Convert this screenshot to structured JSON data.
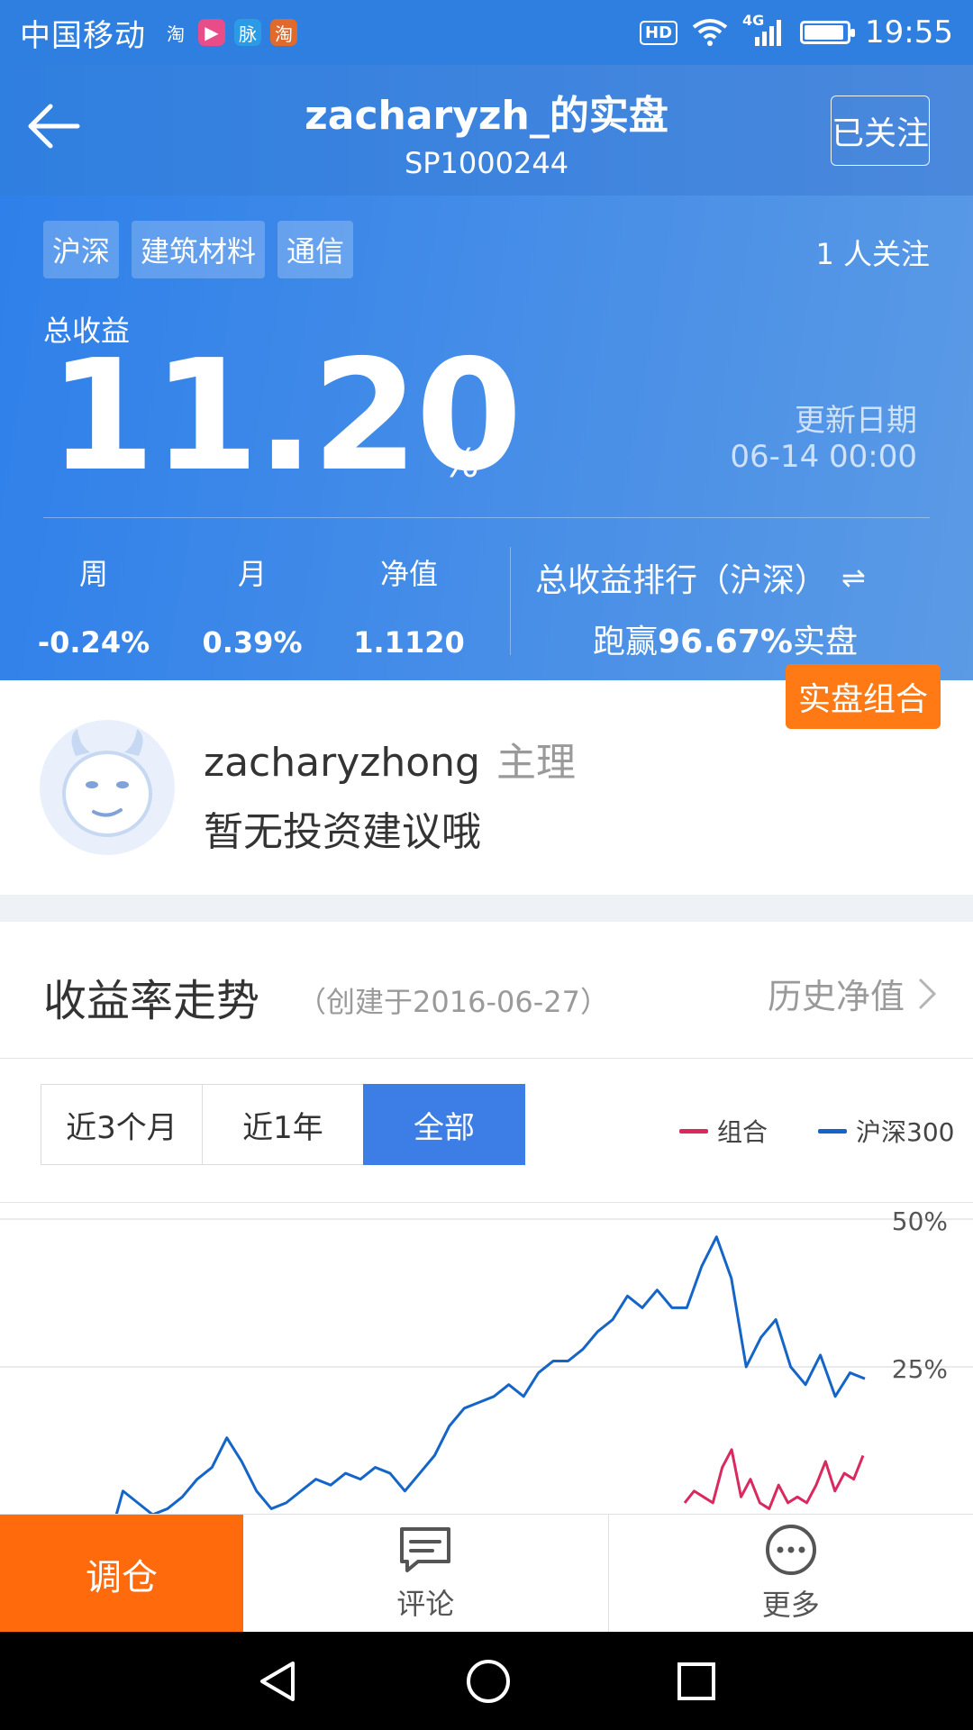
{
  "status_bar": {
    "carrier": "中国移动",
    "app_icons": [
      {
        "glyph": "淘",
        "name": "taobao-icon",
        "color": "#2f7fe0"
      },
      {
        "glyph": "▶",
        "name": "video-app-icon",
        "color": "#e84d8a"
      },
      {
        "glyph": "脉",
        "name": "maimai-icon",
        "color": "#2b9be6"
      },
      {
        "glyph": "淘",
        "name": "taobao-orange-icon",
        "color": "#e06a2c"
      }
    ],
    "network": "4G",
    "hd": "HD",
    "time": "19:55"
  },
  "header": {
    "title": "zacharyzh_的实盘",
    "subtitle": "SP1000244",
    "follow_label": "已关注"
  },
  "summary": {
    "tags": [
      "沪深",
      "建筑材料",
      "通信"
    ],
    "followers": "1 人关注",
    "total_return_label": "总收益",
    "total_return_value": "11.20",
    "total_return_unit": "%",
    "update_label": "更新日期",
    "update_value": "06-14 00:00",
    "stats": [
      {
        "label": "周",
        "value": "-0.24%"
      },
      {
        "label": "月",
        "value": "0.39%"
      },
      {
        "label": "净值",
        "value": "1.1120"
      }
    ],
    "rank_label": "总收益排行（沪深）",
    "rank_switch_icon": "⇌",
    "beat_prefix": "跑赢",
    "beat_value": "96.67%",
    "beat_suffix": "实盘",
    "badge": "实盘组合"
  },
  "manager": {
    "name": "zacharyzhong",
    "role": "主理",
    "note": "暂无投资建议哦"
  },
  "chart_section": {
    "title": "收益率走势",
    "created": "（创建于2016-06-27）",
    "history_link": "历史净值",
    "ranges": [
      "近3个月",
      "近1年",
      "全部"
    ],
    "active_range": "全部",
    "legend": [
      {
        "name": "组合",
        "color": "#d9295f"
      },
      {
        "name": "沪深300",
        "color": "#1565c8"
      }
    ]
  },
  "chart_data": {
    "type": "line",
    "y_ticks": [
      "50%",
      "25%"
    ],
    "ylim": [
      0,
      50
    ],
    "grid": true,
    "legend_position": "top-right",
    "series": [
      {
        "name": "沪深300",
        "color": "#1565c8",
        "values": [
          -5,
          4,
          2,
          0,
          1,
          3,
          6,
          8,
          13,
          9,
          4,
          1,
          2,
          4,
          6,
          5,
          7,
          6,
          8,
          7,
          4,
          7,
          10,
          15,
          18,
          19,
          20,
          22,
          20,
          24,
          26,
          26,
          28,
          31,
          33,
          37,
          35,
          38,
          35,
          35,
          42,
          47,
          40,
          25,
          30,
          33,
          25,
          22,
          27,
          20,
          24,
          23
        ]
      },
      {
        "name": "组合",
        "color": "#d9295f",
        "offset": 38,
        "values": [
          2,
          4,
          3,
          2,
          8,
          11,
          3,
          6,
          2,
          1,
          5,
          2,
          3,
          2,
          5,
          9,
          4,
          7,
          6,
          10
        ]
      }
    ]
  },
  "toolbar": {
    "primary": "调仓",
    "comment": "评论",
    "more": "更多"
  }
}
